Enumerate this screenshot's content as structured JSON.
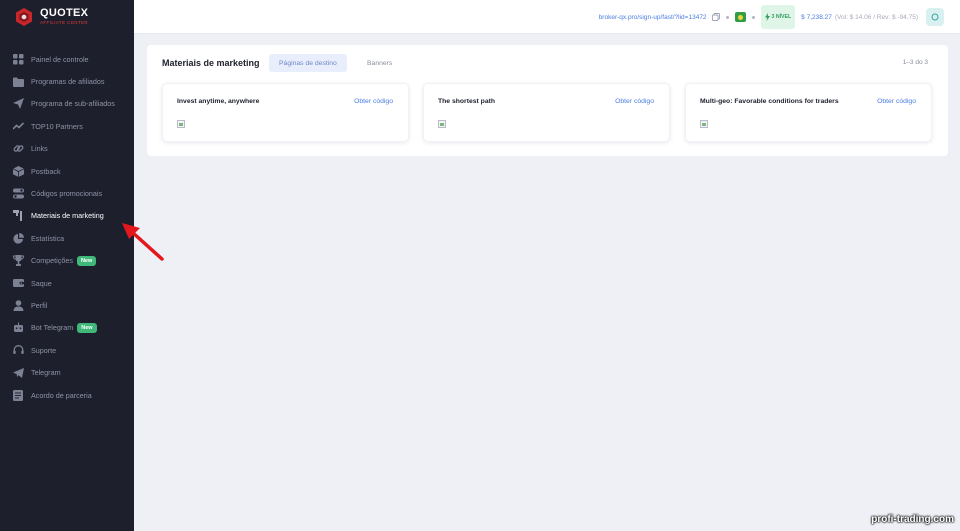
{
  "brand": {
    "name": "QUOTEX",
    "subtitle": "AFFILIATE CENTER",
    "accent": "#e23a3a"
  },
  "sidebar": {
    "items": [
      {
        "label": "Painel de controle",
        "icon": "dashboard-icon",
        "active": false
      },
      {
        "label": "Programas de afiliados",
        "icon": "folder-icon",
        "active": false
      },
      {
        "label": "Programa de sub-afiliados",
        "icon": "paper-plane-icon",
        "active": false
      },
      {
        "label": "TOP10 Partners",
        "icon": "trend-icon",
        "active": false
      },
      {
        "label": "Links",
        "icon": "link-icon",
        "active": false
      },
      {
        "label": "Postback",
        "icon": "box-icon",
        "active": false
      },
      {
        "label": "Códigos promocionais",
        "icon": "toggle-icon",
        "active": false
      },
      {
        "label": "Materiais de marketing",
        "icon": "flag-icon",
        "active": true
      },
      {
        "label": "Estatística",
        "icon": "pie-chart-icon",
        "active": false
      },
      {
        "label": "Competições",
        "icon": "trophy-icon",
        "active": false,
        "badge": "New"
      },
      {
        "label": "Saque",
        "icon": "wallet-icon",
        "active": false
      },
      {
        "label": "Perfil",
        "icon": "user-icon",
        "active": false
      },
      {
        "label": "Bot Telegram",
        "icon": "robot-icon",
        "active": false,
        "badge": "New"
      },
      {
        "label": "Suporte",
        "icon": "headset-icon",
        "active": false
      },
      {
        "label": "Telegram",
        "icon": "telegram-icon",
        "active": false
      },
      {
        "label": "Acordo de parceria",
        "icon": "document-icon",
        "active": false
      }
    ]
  },
  "topbar": {
    "ref_link": "broker-qx.pro/sign-up/fast/?lid=13472",
    "level": "3 NÍVEL",
    "balance": "$ 7,238.27",
    "balance_extra": "(Vol: $ 14.06 / Rev: $ -94.75)",
    "avatar": "O"
  },
  "main": {
    "title": "Materiais de marketing",
    "tabs": [
      {
        "label": "Páginas de destino",
        "active": true
      },
      {
        "label": "Banners",
        "active": false
      }
    ],
    "pagination": "1–3 do 3",
    "cards": [
      {
        "title": "Invest anytime, anywhere",
        "action": "Obter código"
      },
      {
        "title": "The shortest path",
        "action": "Obter código"
      },
      {
        "title": "Multi-geo: Favorable conditions for traders",
        "action": "Obter código"
      }
    ]
  },
  "watermark": "profi-trading.com",
  "colors": {
    "sidebar_bg": "#1d1f2c",
    "page_bg": "#eef0f6",
    "link": "#4a7de2",
    "badge_green": "#3fb879",
    "annotation_arrow": "#e3171c"
  }
}
